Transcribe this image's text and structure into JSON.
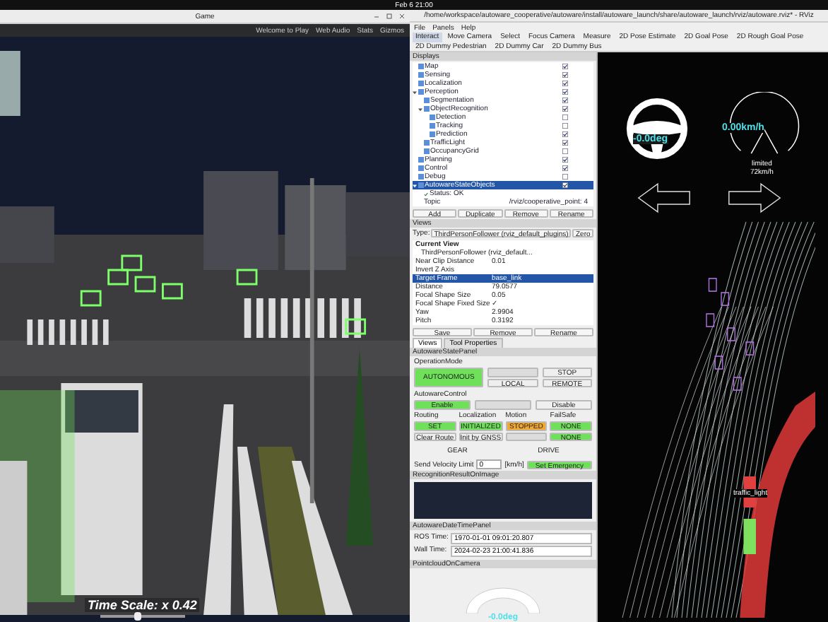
{
  "system_bar": {
    "clock": "Feb 6 21:00"
  },
  "game_window": {
    "title": "Game",
    "menu_right": [
      "Welcome to Play",
      "Web Audio",
      "Stats",
      "Gizmos"
    ],
    "time_scale": {
      "label": "Time Scale: x 0.42",
      "level": 0.45
    }
  },
  "rviz_window": {
    "title": "/home/workspace/autoware_cooperative/autoware/install/autoware_launch/share/autoware_launch/rviz/autoware.rviz* - RViz",
    "menu": [
      "File",
      "Panels",
      "Help"
    ],
    "tools": [
      {
        "label": "Interact",
        "selected": true
      },
      {
        "label": "Move Camera",
        "selected": false
      },
      {
        "label": "Select",
        "selected": false
      },
      {
        "label": "Focus Camera",
        "selected": false
      },
      {
        "label": "Measure",
        "selected": false
      },
      {
        "label": "2D Pose Estimate",
        "selected": false
      },
      {
        "label": "2D Goal Pose",
        "selected": false
      },
      {
        "label": "2D Rough Goal Pose",
        "selected": false
      },
      {
        "label": "2D Dummy Pedestrian",
        "selected": false
      },
      {
        "label": "2D Dummy Car",
        "selected": false
      },
      {
        "label": "2D Dummy Bus",
        "selected": false
      }
    ],
    "displays": {
      "title": "Displays",
      "items": [
        {
          "label": "Map",
          "checked": true
        },
        {
          "label": "Sensing",
          "checked": true
        },
        {
          "label": "Localization",
          "checked": true
        },
        {
          "label": "Perception",
          "checked": true,
          "expanded": true,
          "children": [
            {
              "label": "Segmentation",
              "checked": true
            },
            {
              "label": "ObjectRecognition",
              "checked": true,
              "expanded": true,
              "children": [
                {
                  "label": "Detection",
                  "checked": false
                },
                {
                  "label": "Tracking",
                  "checked": false
                },
                {
                  "label": "Prediction",
                  "checked": true
                }
              ]
            },
            {
              "label": "TrafficLight",
              "checked": true
            },
            {
              "label": "OccupancyGrid",
              "checked": false
            }
          ]
        },
        {
          "label": "Planning",
          "checked": true
        },
        {
          "label": "Control",
          "checked": true
        },
        {
          "label": "Debug",
          "checked": false
        },
        {
          "label": "AutowareStateObjects",
          "checked": true,
          "selected": true,
          "expanded": true,
          "children": [
            {
              "label": "Status: OK",
              "kind": "status"
            },
            {
              "label": "Topic",
              "kind": "property",
              "value": "/rviz/cooperative_point: 4"
            }
          ]
        }
      ],
      "buttons": [
        "Add",
        "Duplicate",
        "Remove",
        "Rename"
      ]
    },
    "views": {
      "title": "Views",
      "type_label": "Type:",
      "type_value": "ThirdPersonFollower (rviz_default_plugins)",
      "zero_button": "Zero",
      "current_view": "Current View",
      "current_value": "ThirdPersonFollower (rviz_default...",
      "properties": [
        {
          "name": "Near Clip Distance",
          "value": "0.01",
          "selected": false
        },
        {
          "name": "Invert Z Axis",
          "selected": false
        },
        {
          "name": "Target Frame",
          "value": "base_link",
          "selected": true
        },
        {
          "name": "Distance",
          "value": "79.0577",
          "selected": false
        },
        {
          "name": "Focal Shape Size",
          "value": "0.05",
          "selected": false
        },
        {
          "name": "Focal Shape Fixed Size",
          "value": "✓",
          "selected": false
        },
        {
          "name": "Yaw",
          "value": "2.9904",
          "selected": false
        },
        {
          "name": "Pitch",
          "value": "0.3192",
          "selected": false
        }
      ],
      "buttons": [
        "Save",
        "Remove",
        "Rename"
      ],
      "tabs": [
        {
          "label": "Views",
          "selected": true
        },
        {
          "label": "Tool Properties",
          "selected": false
        }
      ]
    },
    "state_panel": {
      "title": "AutowareStatePanel",
      "operation": {
        "title": "OperationMode",
        "buttons": [
          {
            "label": "AUTONOMOUS",
            "color": "#6fe05a"
          },
          {
            "color": "#dcdcdc"
          },
          {
            "label": "STOP",
            "color": "#efefef"
          },
          {
            "label": "LOCAL",
            "color": "#efefef"
          },
          {
            "label": "REMOTE",
            "color": "#efefef"
          }
        ]
      },
      "control": {
        "title": "AutowareControl",
        "buttons": [
          {
            "label": "Enable",
            "color": "#6fe05a"
          },
          {
            "color": "#dcdcdc"
          },
          {
            "label": "Disable",
            "color": "#efefef"
          }
        ]
      },
      "groups": [
        {
          "title": "Routing",
          "buttons": [
            {
              "label": "SET",
              "color": "#6fe05a"
            },
            {
              "label": "Clear Route",
              "color": "#efefef"
            }
          ]
        },
        {
          "title": "Localization",
          "buttons": [
            {
              "label": "INITIALIZED",
              "color": "#6fe05a"
            },
            {
              "label": "Init by GNSS",
              "color": "#efefef"
            }
          ]
        },
        {
          "title": "Motion",
          "buttons": [
            {
              "label": "STOPPED",
              "color": "#f0a830"
            },
            {
              "color": "#dcdcdc"
            }
          ]
        },
        {
          "title": "FailSafe",
          "buttons": [
            {
              "label": "NONE",
              "color": "#6fe05a"
            },
            {
              "label": "NONE",
              "color": "#6fe05a"
            }
          ]
        }
      ],
      "gear_label": "GEAR",
      "gear_value": "DRIVE",
      "velocity_label": "Send Velocity Limit",
      "velocity_value": "0",
      "velocity_unit": "[km/h]",
      "emergency_button": "Set Emergency"
    },
    "image_panel": {
      "title": "RecognitionResultOnImage"
    },
    "datetime_panel": {
      "title": "AutowareDateTimePanel",
      "ros_label": "ROS Time:",
      "ros_value": "1970-01-01 09:01:20.807",
      "wall_label": "Wall Time:",
      "wall_value": "2024-02-23 21:00:41.836"
    },
    "camera_panel": {
      "title": "PointcloudOnCamera",
      "gauge_reading": "-0.0deg"
    },
    "view": {
      "steering": "-0.0deg",
      "speed": "0.00km/h",
      "limit_label": "limited",
      "limit_value": "72km/h",
      "traffic_label": "traffic_light"
    }
  }
}
